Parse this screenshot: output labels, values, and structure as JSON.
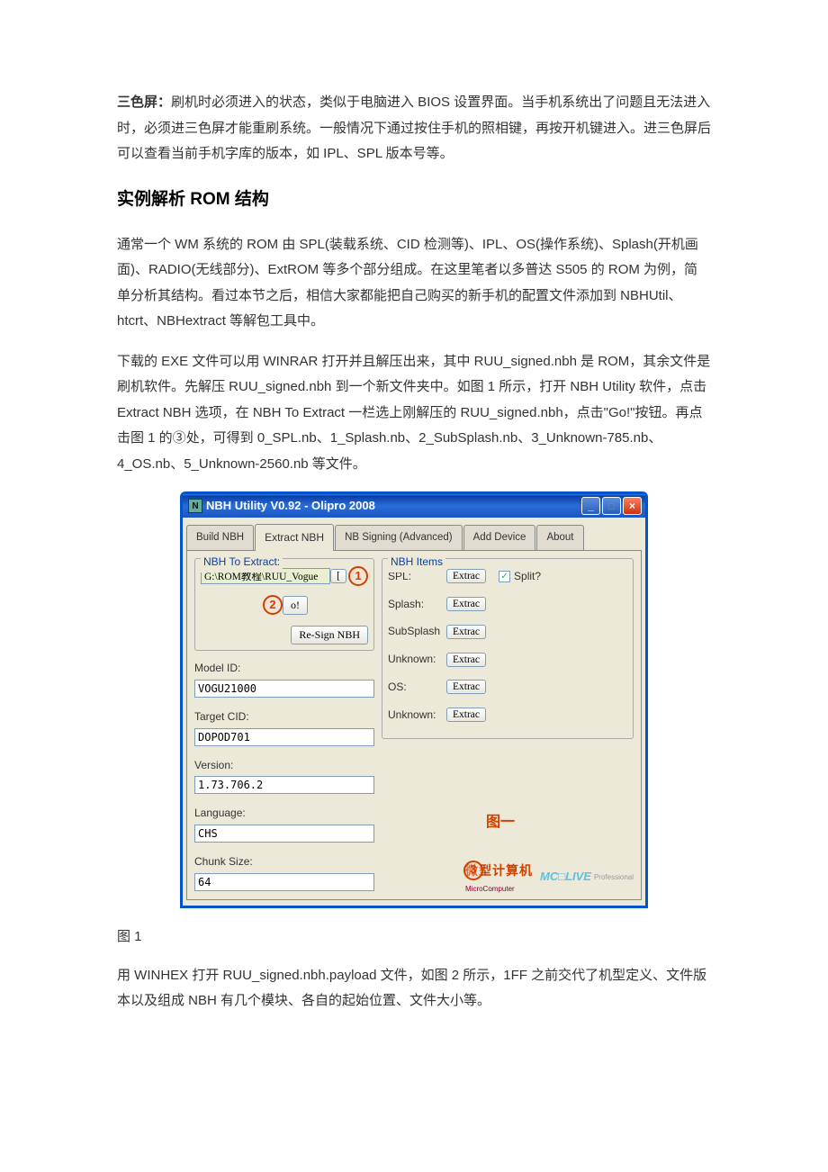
{
  "intro": {
    "label": "三色屏：",
    "text": "刷机时必须进入的状态，类似于电脑进入 BIOS 设置界面。当手机系统出了问题且无法进入时，必须进三色屏才能重刷系统。一般情况下通过按住手机的照相键，再按开机键进入。进三色屏后可以查看当前手机字库的版本，如 IPL、SPL 版本号等。"
  },
  "heading": "实例解析 ROM 结构",
  "para1": "通常一个 WM 系统的 ROM 由 SPL(装载系统、CID 检测等)、IPL、OS(操作系统)、Splash(开机画面)、RADIO(无线部分)、ExtROM 等多个部分组成。在这里笔者以多普达 S505 的 ROM 为例，简单分析其结构。看过本节之后，相信大家都能把自己购买的新手机的配置文件添加到 NBHUtil、htcrt、NBHextract 等解包工具中。",
  "para2": "下载的 EXE 文件可以用 WINRAR 打开并且解压出来，其中 RUU_signed.nbh 是 ROM，其余文件是刷机软件。先解压 RUU_signed.nbh 到一个新文件夹中。如图 1 所示，打开 NBH Utility 软件，点击 Extract NBH 选项，在 NBH To Extract 一栏选上刚解压的 RUU_signed.nbh，点击\"Go!\"按钮。再点击图 1 的③处，可得到 0_SPL.nb、1_Splash.nb、2_SubSplash.nb、3_Unknown-785.nb、4_OS.nb、5_Unknown-2560.nb 等文件。",
  "caption1": "图 1",
  "para3": "用 WINHEX 打开 RUU_signed.nbh.payload 文件，如图 2 所示，1FF 之前交代了机型定义、文件版本以及组成 NBH 有几个模块、各自的起始位置、文件大小等。",
  "app": {
    "title_icon": "N",
    "title": "NBH Utility V0.92 - Olipro 2008",
    "win_min": "_",
    "win_max": "□",
    "win_close": "×",
    "tabs": [
      "Build NBH",
      "Extract NBH",
      "NB Signing (Advanced)",
      "Add Device",
      "About"
    ],
    "left": {
      "group1_legend": "NBH To Extract:",
      "path_value": "G:\\ROM教程\\RUU_Vogue",
      "badge1": "1",
      "go_badge": "2",
      "go_label": "o!",
      "resign_btn": "Re-Sign NBH",
      "model_label": "Model ID:",
      "model_value": "VOGU21000",
      "target_label": "Target CID:",
      "target_value": "DOPOD701",
      "version_label": "Version:",
      "version_value": "1.73.706.2",
      "language_label": "Language:",
      "language_value": "CHS",
      "chunk_label": "Chunk Size:",
      "chunk_value": "64"
    },
    "right": {
      "legend": "NBH Items",
      "rows": [
        {
          "label": "SPL:",
          "btn": "Extrac",
          "split_label": "Split?",
          "split": true
        },
        {
          "label": "Splash:",
          "btn": "Extrac"
        },
        {
          "label": "SubSplash",
          "btn": "Extrac"
        },
        {
          "label": "Unknown:",
          "btn": "Extrac"
        },
        {
          "label": "OS:",
          "btn": "Extrac"
        },
        {
          "label": "Unknown:",
          "btn": "Extrac"
        }
      ],
      "badge3": "3",
      "figlabel": "图一",
      "footer_cn": "微型计算机",
      "footer_en": "MicroComputer",
      "footer_live": "MC□LIVE",
      "footer_prof": "Professional"
    }
  }
}
